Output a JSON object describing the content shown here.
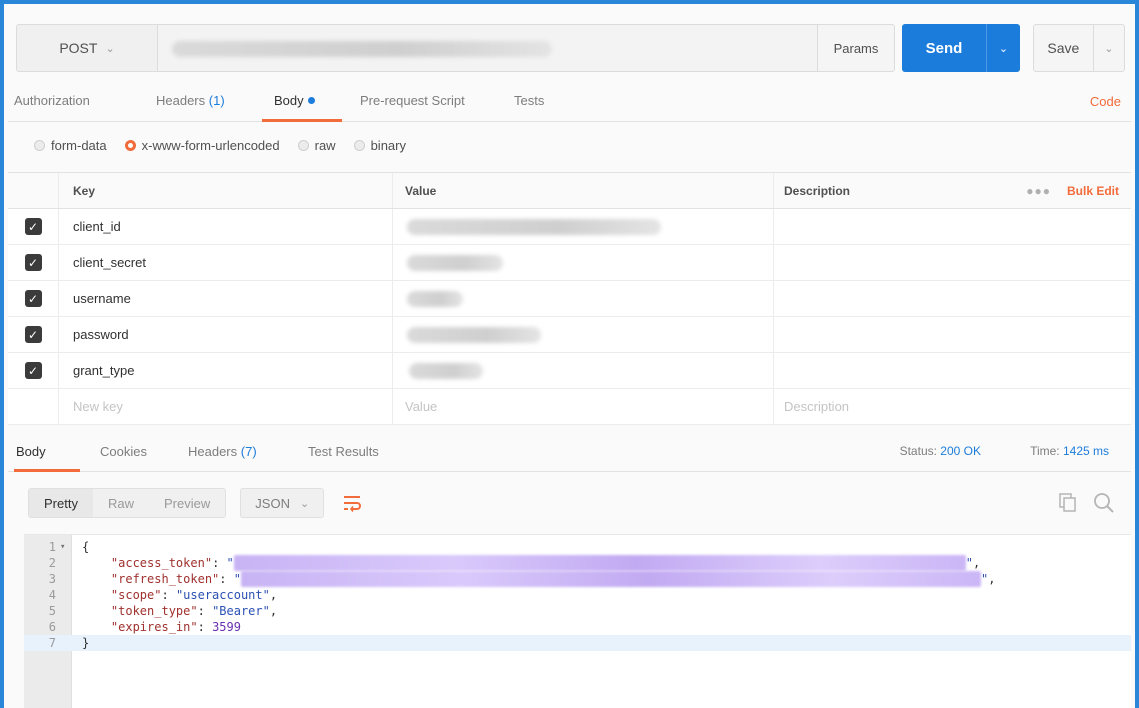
{
  "request": {
    "method": "POST",
    "params_label": "Params",
    "send_label": "Send",
    "save_label": "Save"
  },
  "request_tabs": {
    "authorization": "Authorization",
    "headers_label": "Headers",
    "headers_count": "(1)",
    "body": "Body",
    "pre_request_script": "Pre-request Script",
    "tests": "Tests",
    "code": "Code"
  },
  "body_types": {
    "options": [
      "form-data",
      "x-www-form-urlencoded",
      "raw",
      "binary"
    ],
    "selected": "x-www-form-urlencoded"
  },
  "params_table": {
    "headers": {
      "key": "Key",
      "value": "Value",
      "description": "Description"
    },
    "bulk_edit": "Bulk Edit",
    "rows": [
      {
        "key": "client_id",
        "checked": true
      },
      {
        "key": "client_secret",
        "checked": true
      },
      {
        "key": "username",
        "checked": true
      },
      {
        "key": "password",
        "checked": true
      },
      {
        "key": "grant_type",
        "checked": true
      }
    ],
    "new_row": {
      "key_placeholder": "New key",
      "value_placeholder": "Value",
      "description_placeholder": "Description"
    }
  },
  "response_tabs": {
    "body": "Body",
    "cookies": "Cookies",
    "headers_label": "Headers",
    "headers_count": "(7)",
    "test_results": "Test Results"
  },
  "response_status": {
    "status_label": "Status:",
    "status_value": "200 OK",
    "time_label": "Time:",
    "time_value": "1425 ms"
  },
  "response_view": {
    "modes": [
      "Pretty",
      "Raw",
      "Preview"
    ],
    "selected_mode": "Pretty",
    "format": "JSON"
  },
  "response_body": {
    "line_numbers": [
      "1",
      "2",
      "3",
      "4",
      "5",
      "6",
      "7"
    ],
    "open_brace": "{",
    "close_brace": "}",
    "access_token_key": "\"access_token\"",
    "refresh_token_key": "\"refresh_token\"",
    "scope_key": "\"scope\"",
    "scope_value": "\"useraccount\"",
    "token_type_key": "\"token_type\"",
    "token_type_value": "\"Bearer\"",
    "expires_in_key": "\"expires_in\"",
    "expires_in_value": "3599"
  },
  "colors": {
    "accent_orange": "#f26b3a",
    "send_blue": "#1c7cdb",
    "frame_blue": "#2a86d9"
  }
}
